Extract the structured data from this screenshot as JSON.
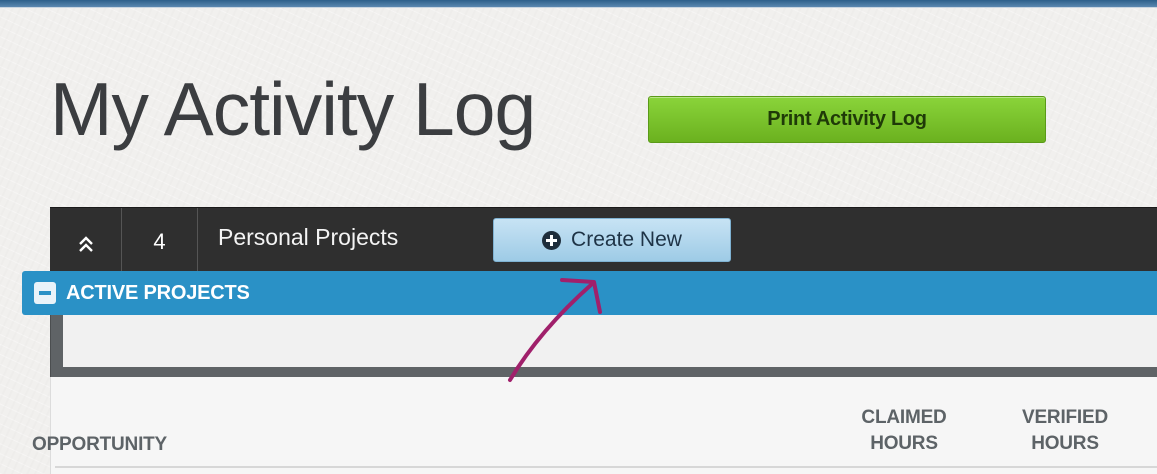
{
  "page": {
    "title": "My Activity Log",
    "print_button": "Print Activity Log"
  },
  "section": {
    "collapse_icon": "double-chevron-up-icon",
    "count": "4",
    "label": "Personal Projects",
    "create_button": "Create New",
    "create_icon": "plus-circle-icon"
  },
  "active_projects": {
    "label": "ACTIVE PROJECTS",
    "toggle_icon": "minus-square-icon"
  },
  "table": {
    "columns": {
      "opportunity": "OPPORTUNITY",
      "claimed_line1": "CLAIMED",
      "claimed_line2": "HOURS",
      "verified_line1": "VERIFIED",
      "verified_line2": "HOURS"
    }
  },
  "colors": {
    "accent_green": "#7cc42c",
    "accent_blue": "#2a91c6",
    "dark_bar": "#2f2f2f",
    "annotation_arrow": "#a0206b"
  }
}
